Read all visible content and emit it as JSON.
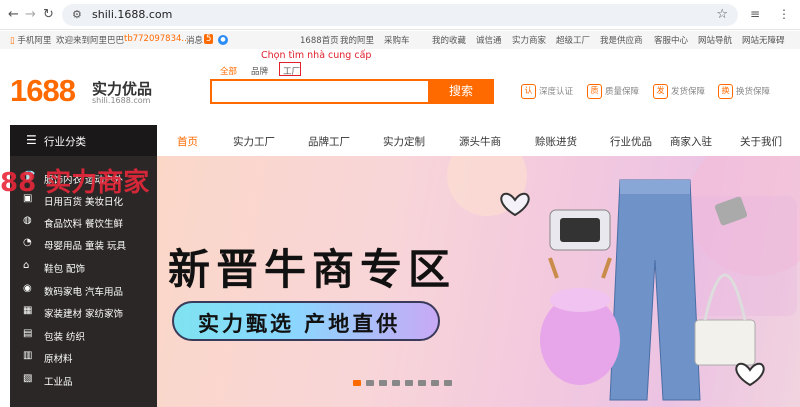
{
  "browser": {
    "url": "shili.1688.com"
  },
  "topbar": {
    "phone_link": "手机阿里",
    "welcome": "欢迎来到阿里巴巴",
    "username": "tb772097834...",
    "messages_label": "消息",
    "messages_badge": "5",
    "links": [
      "1688首页",
      "我的阿里",
      "采购车",
      "我的收藏",
      "诚信通",
      "实力商家",
      "超级工厂",
      "我是供应商",
      "客服中心",
      "网站导航",
      "网站无障碍"
    ]
  },
  "header": {
    "logo_number": "1688",
    "logo_title": "实力优品",
    "logo_domain": "shili.1688.com",
    "annotation": "Chọn tìm nhà cung cấp",
    "search_tabs": [
      "全部",
      "品牌",
      "工厂"
    ],
    "search_value": "",
    "search_button": "搜索",
    "guarantees": [
      {
        "icon": "认",
        "label": "深度认证"
      },
      {
        "icon": "质",
        "label": "质量保障"
      },
      {
        "icon": "发",
        "label": "发货保障"
      },
      {
        "icon": "换",
        "label": "换货保障"
      }
    ]
  },
  "sidebar": {
    "title": "行业分类",
    "categories": [
      {
        "icon": "shirt-icon",
        "label": "服饰内衣  运动户外"
      },
      {
        "icon": "bag-icon",
        "label": "日用百货  美妆日化"
      },
      {
        "icon": "food-icon",
        "label": "食品饮料  餐饮生鲜"
      },
      {
        "icon": "baby-icon",
        "label": "母婴用品  童装  玩具"
      },
      {
        "icon": "shoe-icon",
        "label": "鞋包  配饰"
      },
      {
        "icon": "camera-icon",
        "label": "数码家电  汽车用品"
      },
      {
        "icon": "home-icon",
        "label": "家装建材  家纺家饰"
      },
      {
        "icon": "package-icon",
        "label": "包装  纺织"
      },
      {
        "icon": "material-icon",
        "label": "原材料"
      },
      {
        "icon": "industry-icon",
        "label": "工业品"
      }
    ]
  },
  "nav": {
    "items": [
      "首页",
      "实力工厂",
      "品牌工厂",
      "实力定制",
      "源头牛商",
      "赊账进货",
      "行业优品",
      "商家入驻",
      "关于我们"
    ],
    "active_index": 0
  },
  "banner": {
    "title": "新晋牛商专区",
    "pill_text": "实力甄选  产地直供",
    "overlay_text": "88  实力商家",
    "slide_count": 8,
    "active_slide": 0
  },
  "colors": {
    "brand": "#ff6a00",
    "annotation": "#e0202a"
  }
}
